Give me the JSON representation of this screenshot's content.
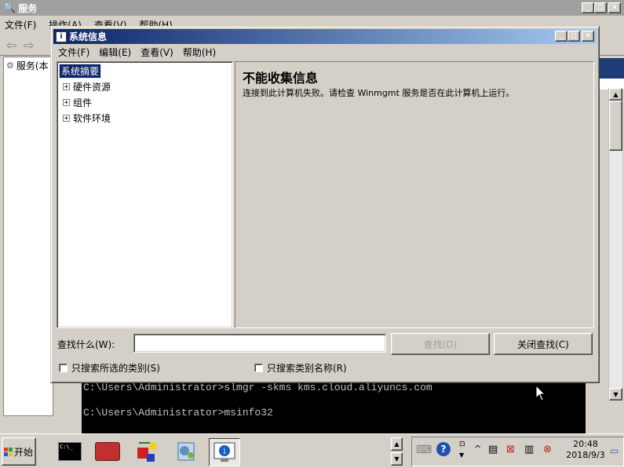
{
  "services_window": {
    "title": "服务",
    "menu": [
      "文件(F)",
      "操作(A)",
      "查看(V)",
      "帮助(H)"
    ],
    "tree_item": "服务(本"
  },
  "msinfo_window": {
    "title": "系统信息",
    "menu": [
      "文件(F)",
      "编辑(E)",
      "查看(V)",
      "帮助(H)"
    ],
    "tree": {
      "root": "系统摘要",
      "children": [
        "硬件资源",
        "组件",
        "软件环境"
      ]
    },
    "detail": {
      "heading": "不能收集信息",
      "message": "连接到此计算机失败。请检查 Winmgmt 服务是否在此计算机上运行。"
    },
    "find": {
      "label": "查找什么(W):",
      "value": "",
      "find_button": "查找(D)",
      "close_find_button": "关闭查找(C)",
      "option_selected_category": "只搜索所选的类别(S)",
      "option_category_names": "只搜索类别名称(R)"
    }
  },
  "console": {
    "lines": [
      "C:\\Users\\Administrator>slmgr -skms kms.cloud.aliyuncs.com",
      "",
      "C:\\Users\\Administrator>msinfo32"
    ]
  },
  "taskbar": {
    "start_label": "开始",
    "clock_time": "20:48",
    "clock_date": "2018/9/3"
  },
  "colors": {
    "title_active_start": "#0a246a",
    "title_active_end": "#a6caf0",
    "title_inactive": "#a0a0a0",
    "selection": "#0a246a"
  }
}
